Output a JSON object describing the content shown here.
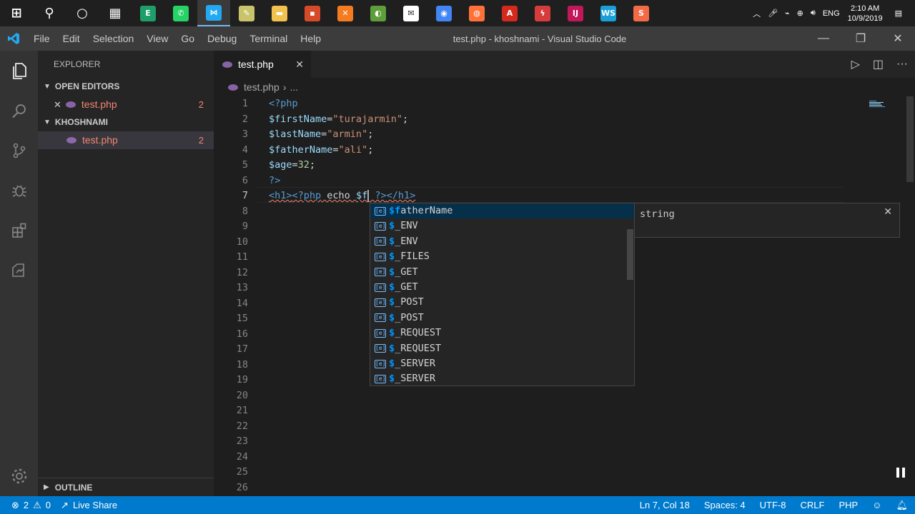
{
  "taskbar": {
    "apps": [
      {
        "name": "windows-start-icon",
        "glyph": "⊞",
        "color": "#1f1f1f"
      },
      {
        "name": "search-icon",
        "glyph": "⚲",
        "color": "#1f1f1f"
      },
      {
        "name": "cortana-icon",
        "glyph": "○",
        "color": "#1f1f1f"
      },
      {
        "name": "task-view-icon",
        "glyph": "▦",
        "color": "#1f1f1f"
      },
      {
        "name": "app-green-e-icon",
        "glyph": "E",
        "color": "#1e9e6a"
      },
      {
        "name": "whatsapp-icon",
        "glyph": "✆",
        "color": "#25d366"
      },
      {
        "name": "vscode-taskbar-icon",
        "glyph": "⋈",
        "color": "#23a9f2"
      },
      {
        "name": "notes-icon",
        "glyph": "✎",
        "color": "#c9c46a"
      },
      {
        "name": "file-explorer-icon",
        "glyph": "▬",
        "color": "#f2c14e"
      },
      {
        "name": "app-tiles-icon",
        "glyph": "▪",
        "color": "#d64a2a"
      },
      {
        "name": "xampp-icon",
        "glyph": "✕",
        "color": "#f47b20"
      },
      {
        "name": "paint-icon",
        "glyph": "◐",
        "color": "#5d9e3b"
      },
      {
        "name": "mail-icon",
        "glyph": "✉",
        "color": "#ffffff"
      },
      {
        "name": "chrome-icon",
        "glyph": "◉",
        "color": "#4285f4"
      },
      {
        "name": "firefox-icon",
        "glyph": "◍",
        "color": "#ff7139"
      },
      {
        "name": "acrobat-icon",
        "glyph": "A",
        "color": "#d42a1e"
      },
      {
        "name": "flash-icon",
        "glyph": "ϟ",
        "color": "#d63c3c"
      },
      {
        "name": "intellij-icon",
        "glyph": "IJ",
        "color": "#c2185b"
      },
      {
        "name": "webstorm-icon",
        "glyph": "WS",
        "color": "#1aa0d8"
      },
      {
        "name": "sublime-icon",
        "glyph": "S",
        "color": "#f36b46"
      }
    ],
    "language": "ENG",
    "time": "2:10 AM",
    "date": "10/9/2019"
  },
  "titlebar": {
    "menu": [
      "File",
      "Edit",
      "Selection",
      "View",
      "Go",
      "Debug",
      "Terminal",
      "Help"
    ],
    "title": "test.php - khoshnami - Visual Studio Code"
  },
  "sidebar": {
    "title": "EXPLORER",
    "open_editors_label": "OPEN EDITORS",
    "open_editor_file": "test.php",
    "open_editor_count": "2",
    "folder_label": "KHOSHNAMI",
    "folder_file": "test.php",
    "folder_file_count": "2",
    "outline_label": "OUTLINE"
  },
  "editor": {
    "tab_label": "test.php",
    "breadcrumb_file": "test.php",
    "breadcrumb_more": "...",
    "lines": [
      "1",
      "2",
      "3",
      "4",
      "5",
      "6",
      "7",
      "8",
      "9",
      "10",
      "11",
      "12",
      "13",
      "14",
      "15",
      "16",
      "17",
      "18",
      "19",
      "20",
      "21",
      "22",
      "23",
      "24",
      "25",
      "26"
    ],
    "code": {
      "l1": "<?php",
      "l2_var": "$firstName",
      "l2_op": "=",
      "l2_str": "\"turajarmin\"",
      "l2_end": ";",
      "l3_var": "$lastName",
      "l3_op": "=",
      "l3_str": "\"armin\"",
      "l3_end": ";",
      "l4_var": "$fatherName",
      "l4_op": "=",
      "l4_str": "\"ali\"",
      "l4_end": ";",
      "l5_var": "$age",
      "l5_op": "=",
      "l5_num": "32",
      "l5_end": ";",
      "l6": "?>",
      "l7_a": "<h1>",
      "l7_b": "<?php",
      "l7_c": " echo ",
      "l7_d": "$f",
      "l7_e": " ?>",
      "l7_f": "</h1>"
    }
  },
  "suggest": {
    "items": [
      {
        "match": "$f",
        "rest": "atherName"
      },
      {
        "match": "$",
        "rest": "_ENV"
      },
      {
        "match": "$",
        "rest": "_ENV"
      },
      {
        "match": "$",
        "rest": "_FILES"
      },
      {
        "match": "$",
        "rest": "_GET"
      },
      {
        "match": "$",
        "rest": "_GET"
      },
      {
        "match": "$",
        "rest": "_POST"
      },
      {
        "match": "$",
        "rest": "_POST"
      },
      {
        "match": "$",
        "rest": "_REQUEST"
      },
      {
        "match": "$",
        "rest": "_REQUEST"
      },
      {
        "match": "$",
        "rest": "_SERVER"
      },
      {
        "match": "$",
        "rest": "_SERVER"
      }
    ],
    "detail_type": "string"
  },
  "statusbar": {
    "errors": "2",
    "warnings": "0",
    "live_share": "Live Share",
    "position": "Ln 7, Col 18",
    "spaces": "Spaces: 4",
    "encoding": "UTF-8",
    "eol": "CRLF",
    "language": "PHP"
  }
}
